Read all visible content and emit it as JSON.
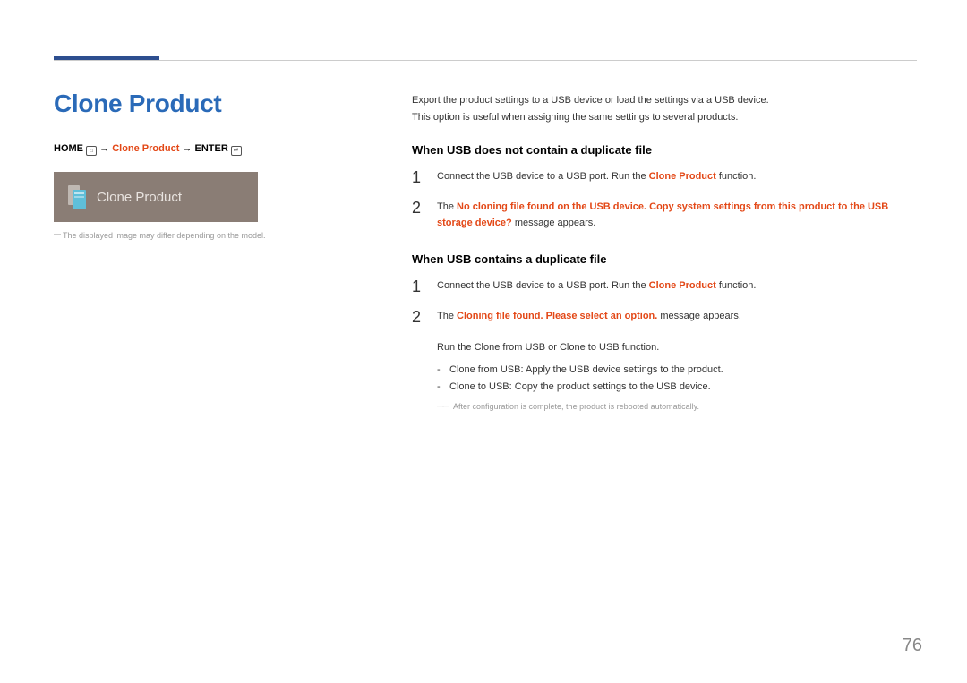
{
  "colors": {
    "title_blue": "#2a6ab8",
    "accent_orange": "#e34817",
    "tile_bg": "#8a7d75"
  },
  "title": "Clone Product",
  "breadcrumb": {
    "home": "HOME",
    "product": "Clone Product",
    "enter": "ENTER",
    "arrow": "→"
  },
  "preview_label": "Clone Product",
  "caption": "The displayed image may differ depending on the model.",
  "intro_line1": "Export the product settings to a USB device or load the settings via a USB device.",
  "intro_line2": "This option is useful when assigning the same settings to several products.",
  "section1": {
    "heading": "When USB does not contain a duplicate file",
    "step1": {
      "num": "1",
      "pre": "Connect the USB device to a USB port. Run the ",
      "bold": "Clone Product",
      "post": " function."
    },
    "step2": {
      "num": "2",
      "pre": "The ",
      "bold": "No cloning file found on the USB device. Copy system settings from this product to the USB storage device?",
      "post": " message appears."
    }
  },
  "section2": {
    "heading": "When USB contains a duplicate file",
    "step1": {
      "num": "1",
      "pre": "Connect the USB device to a USB port. Run the ",
      "bold": "Clone Product",
      "post": " function."
    },
    "step2": {
      "num": "2",
      "pre": "The ",
      "bold": "Cloning file found. Please select an option.",
      "post": " message appears."
    },
    "run_pre": "Run the ",
    "run_bold1": "Clone from USB",
    "run_mid": " or ",
    "run_bold2": "Clone to USB",
    "run_post": " function.",
    "bullet1_bold": "Clone from USB",
    "bullet1_text": ": Apply the USB device settings to the product.",
    "bullet2_bold": "Clone to USB",
    "bullet2_text": ": Copy the product settings to the USB device.",
    "footnote": "After configuration is complete, the product is rebooted automatically."
  },
  "page_number": "76"
}
